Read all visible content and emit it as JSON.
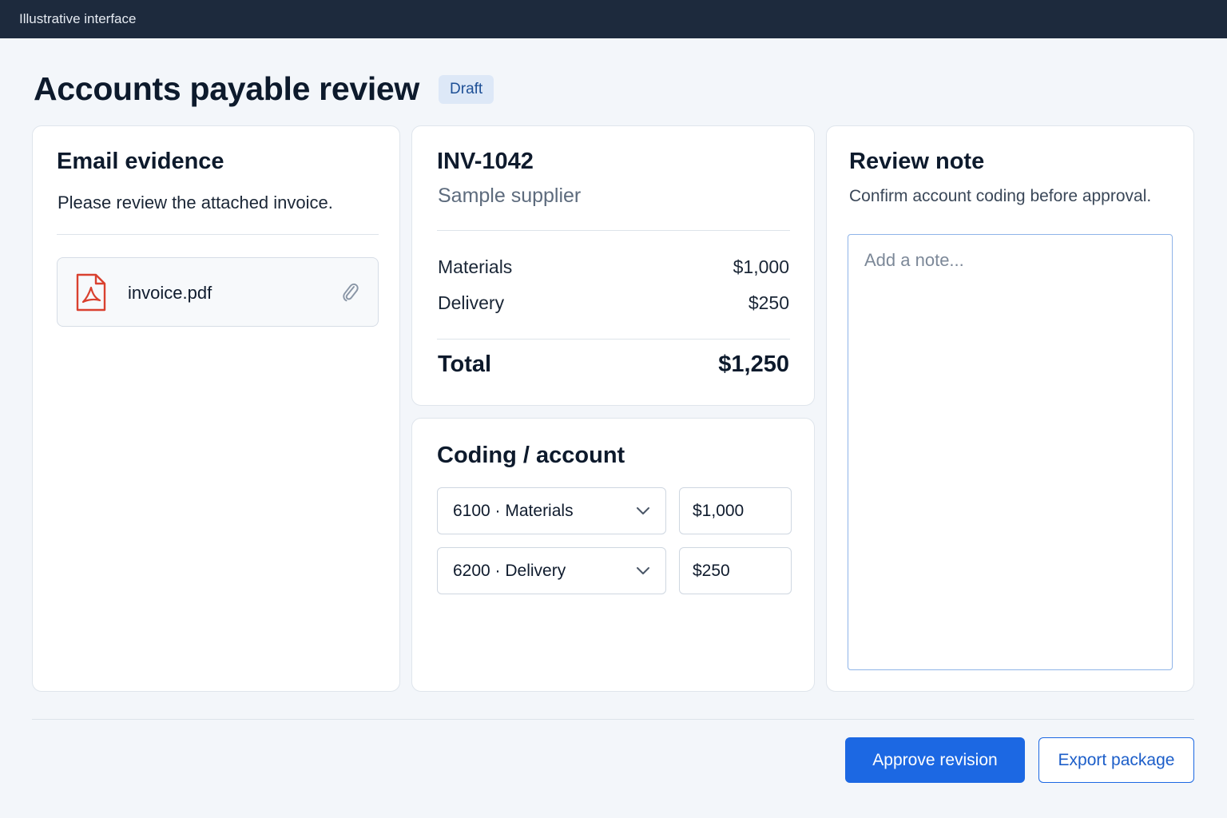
{
  "topbar": {
    "label": "Illustrative interface"
  },
  "header": {
    "title": "Accounts payable review",
    "status": "Draft"
  },
  "email": {
    "title": "Email evidence",
    "message": "Please review the attached invoice.",
    "attachment": {
      "filename": "invoice.pdf",
      "icon": "pdf-file-icon",
      "action_icon": "paperclip-icon"
    }
  },
  "invoice": {
    "id": "INV-1042",
    "supplier": "Sample supplier",
    "lines": [
      {
        "label": "Materials",
        "amount": "$1,000"
      },
      {
        "label": "Delivery",
        "amount": "$250"
      }
    ],
    "total_label": "Total",
    "total_amount": "$1,250"
  },
  "coding": {
    "title": "Coding / account",
    "rows": [
      {
        "account": "6100 · Materials",
        "amount": "$1,000"
      },
      {
        "account": "6200 · Delivery",
        "amount": "$250"
      }
    ]
  },
  "note": {
    "title": "Review note",
    "instruction": "Confirm account coding before approval.",
    "placeholder": "Add a note...",
    "value": ""
  },
  "actions": {
    "approve_label": "Approve revision",
    "export_label": "Export package"
  },
  "colors": {
    "primary": "#1c68e3",
    "topbar": "#1d2a3d",
    "pdf_red": "#d9412f",
    "badge_bg": "#dde8f7"
  }
}
